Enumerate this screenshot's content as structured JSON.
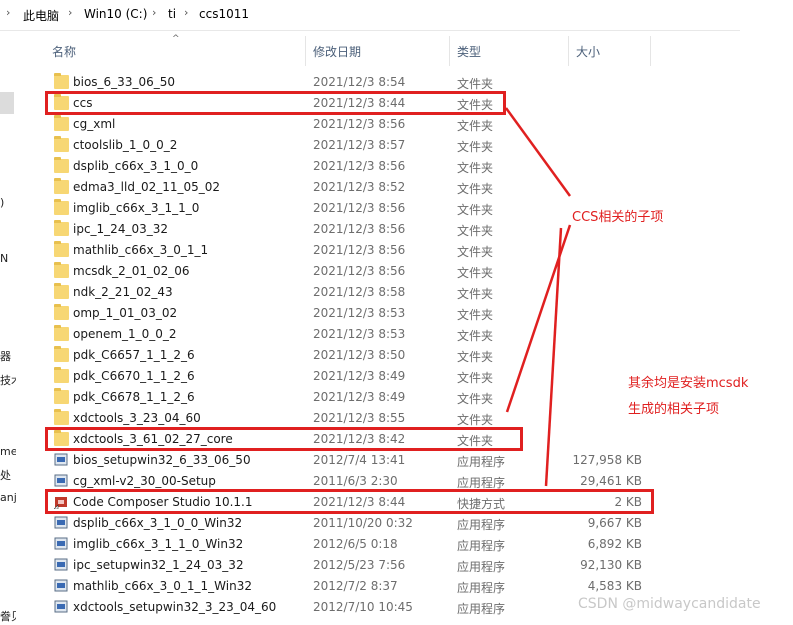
{
  "breadcrumb": [
    "此电脑",
    "Win10 (C:)",
    "ti",
    "ccs1011"
  ],
  "columns": {
    "name": "名称",
    "date": "修改日期",
    "type": "类型",
    "size": "大小"
  },
  "left_pane_fragments": [
    ")",
    "N",
    "器",
    "技术",
    "me",
    "处",
    "anj",
    "誊贝"
  ],
  "rows": [
    {
      "name": "bios_6_33_06_50",
      "date": "2021/12/3 8:54",
      "type": "文件夹",
      "size": "",
      "icon": "folder-icon"
    },
    {
      "name": "ccs",
      "date": "2021/12/3 8:44",
      "type": "文件夹",
      "size": "",
      "icon": "folder-icon"
    },
    {
      "name": "cg_xml",
      "date": "2021/12/3 8:56",
      "type": "文件夹",
      "size": "",
      "icon": "folder-icon"
    },
    {
      "name": "ctoolslib_1_0_0_2",
      "date": "2021/12/3 8:57",
      "type": "文件夹",
      "size": "",
      "icon": "folder-icon"
    },
    {
      "name": "dsplib_c66x_3_1_0_0",
      "date": "2021/12/3 8:56",
      "type": "文件夹",
      "size": "",
      "icon": "folder-icon"
    },
    {
      "name": "edma3_lld_02_11_05_02",
      "date": "2021/12/3 8:52",
      "type": "文件夹",
      "size": "",
      "icon": "folder-icon"
    },
    {
      "name": "imglib_c66x_3_1_1_0",
      "date": "2021/12/3 8:56",
      "type": "文件夹",
      "size": "",
      "icon": "folder-icon"
    },
    {
      "name": "ipc_1_24_03_32",
      "date": "2021/12/3 8:56",
      "type": "文件夹",
      "size": "",
      "icon": "folder-icon"
    },
    {
      "name": "mathlib_c66x_3_0_1_1",
      "date": "2021/12/3 8:56",
      "type": "文件夹",
      "size": "",
      "icon": "folder-icon"
    },
    {
      "name": "mcsdk_2_01_02_06",
      "date": "2021/12/3 8:56",
      "type": "文件夹",
      "size": "",
      "icon": "folder-icon"
    },
    {
      "name": "ndk_2_21_02_43",
      "date": "2021/12/3 8:58",
      "type": "文件夹",
      "size": "",
      "icon": "folder-icon"
    },
    {
      "name": "omp_1_01_03_02",
      "date": "2021/12/3 8:53",
      "type": "文件夹",
      "size": "",
      "icon": "folder-icon"
    },
    {
      "name": "openem_1_0_0_2",
      "date": "2021/12/3 8:53",
      "type": "文件夹",
      "size": "",
      "icon": "folder-icon"
    },
    {
      "name": "pdk_C6657_1_1_2_6",
      "date": "2021/12/3 8:50",
      "type": "文件夹",
      "size": "",
      "icon": "folder-icon"
    },
    {
      "name": "pdk_C6670_1_1_2_6",
      "date": "2021/12/3 8:49",
      "type": "文件夹",
      "size": "",
      "icon": "folder-icon"
    },
    {
      "name": "pdk_C6678_1_1_2_6",
      "date": "2021/12/3 8:49",
      "type": "文件夹",
      "size": "",
      "icon": "folder-icon"
    },
    {
      "name": "xdctools_3_23_04_60",
      "date": "2021/12/3 8:55",
      "type": "文件夹",
      "size": "",
      "icon": "folder-icon"
    },
    {
      "name": "xdctools_3_61_02_27_core",
      "date": "2021/12/3 8:42",
      "type": "文件夹",
      "size": "",
      "icon": "folder-icon"
    },
    {
      "name": "bios_setupwin32_6_33_06_50",
      "date": "2012/7/4 13:41",
      "type": "应用程序",
      "size": "127,958 KB",
      "icon": "installer-icon"
    },
    {
      "name": "cg_xml-v2_30_00-Setup",
      "date": "2011/6/3 2:30",
      "type": "应用程序",
      "size": "29,461 KB",
      "icon": "installer-icon"
    },
    {
      "name": "Code Composer Studio 10.1.1",
      "date": "2021/12/3 8:44",
      "type": "快捷方式",
      "size": "2 KB",
      "icon": "ccs-shortcut-icon"
    },
    {
      "name": "dsplib_c66x_3_1_0_0_Win32",
      "date": "2011/10/20 0:32",
      "type": "应用程序",
      "size": "9,667 KB",
      "icon": "installer-icon"
    },
    {
      "name": "imglib_c66x_3_1_1_0_Win32",
      "date": "2012/6/5 0:18",
      "type": "应用程序",
      "size": "6,892 KB",
      "icon": "installer-icon"
    },
    {
      "name": "ipc_setupwin32_1_24_03_32",
      "date": "2012/5/23 7:56",
      "type": "应用程序",
      "size": "92,130 KB",
      "icon": "installer-icon"
    },
    {
      "name": "mathlib_c66x_3_0_1_1_Win32",
      "date": "2012/7/2 8:37",
      "type": "应用程序",
      "size": "4,583 KB",
      "icon": "installer-icon"
    },
    {
      "name": "xdctools_setupwin32_3_23_04_60",
      "date": "2012/7/10 10:45",
      "type": "应用程序",
      "size": "",
      "icon": "installer-icon"
    }
  ],
  "annotations": {
    "ccs_sub": "CCS相关的子项",
    "rest_line1": "其余均是安装mcsdk",
    "rest_line2": "生成的相关子项",
    "color": "#e02020"
  },
  "watermark": "CSDN @midwaycandidate"
}
